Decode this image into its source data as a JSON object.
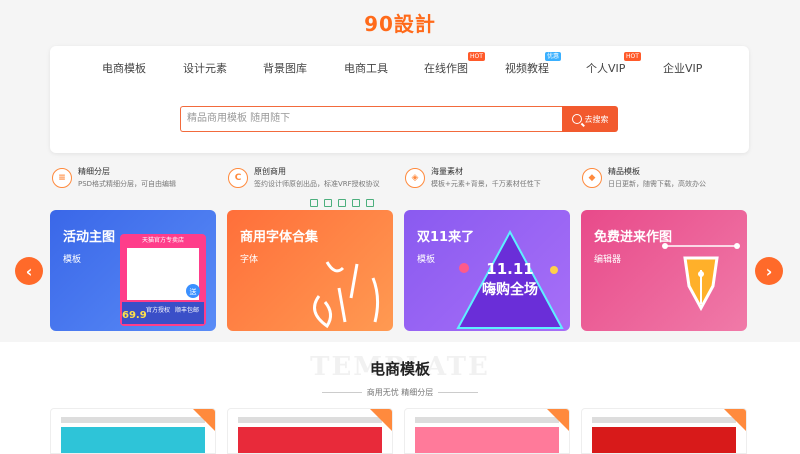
{
  "logo": {
    "text": "90設計"
  },
  "nav": [
    {
      "label": "电商模板"
    },
    {
      "label": "设计元素"
    },
    {
      "label": "背景图库"
    },
    {
      "label": "电商工具"
    },
    {
      "label": "在线作图",
      "badge": "HOT"
    },
    {
      "label": "视频教程",
      "badge": "优惠"
    },
    {
      "label": "个人VIP",
      "badge": "HOT"
    },
    {
      "label": "企业VIP"
    }
  ],
  "search": {
    "placeholder": "精品商用模板 随用随下",
    "button_label": "去搜索"
  },
  "features": [
    {
      "title": "精细分层",
      "desc": "PSD格式精细分层，可自由编辑"
    },
    {
      "title": "原创商用",
      "desc": "签约设计师原创出品，标准VRF授权协议",
      "icon_letter": "C"
    },
    {
      "title": "海量素材",
      "desc": "模板+元素+背景，千万素材任性下"
    },
    {
      "title": "精品模板",
      "desc": "日日更新，随需下载，高效办公"
    }
  ],
  "cards": [
    {
      "title": "活动主图",
      "sub": "模板"
    },
    {
      "title": "商用字体合集",
      "sub": "字体"
    },
    {
      "title": "双11来了",
      "sub": "模板"
    },
    {
      "title": "免费进来作图",
      "sub": "编辑器"
    }
  ],
  "card_art": {
    "c1_banner": "天猫官方专卖店",
    "c1_tag1": "官方授权",
    "c1_tag2": "顺丰包邮",
    "c1_price": "69.9",
    "c1_circle": "送",
    "c3_big": "11.11",
    "c3_big2": "嗨购全场"
  },
  "section": {
    "title": "电商模板",
    "subtitle": "商用无忧 精细分层",
    "bg_text": "TEMPLATE"
  },
  "colors": {
    "accent": "#ff6a1a"
  }
}
